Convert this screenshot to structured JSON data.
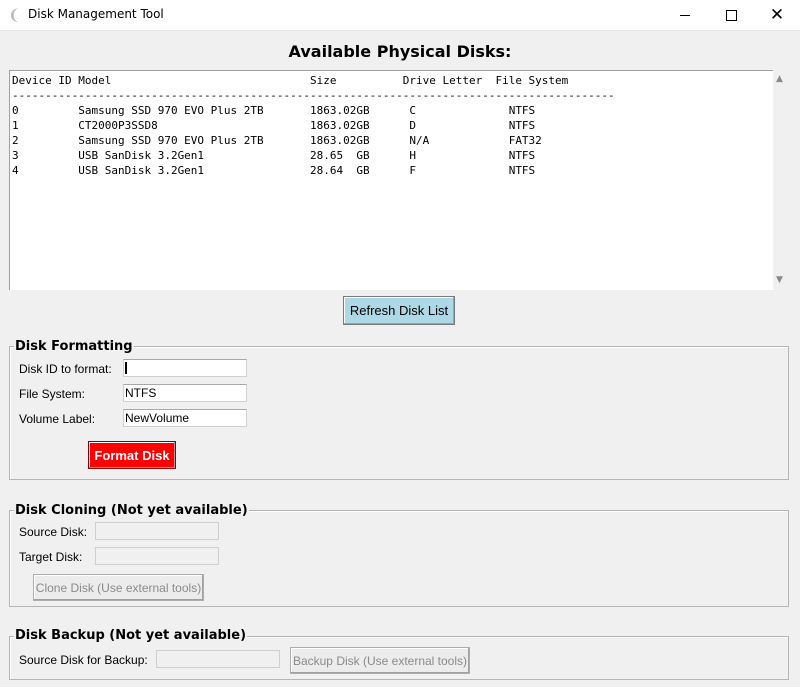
{
  "window": {
    "title": "Disk Management Tool",
    "app_icon": "feather-icon",
    "controls": {
      "minimize": "minimize-icon",
      "maximize": "maximize-icon",
      "close_glyph": "✕"
    }
  },
  "heading": "Available Physical Disks:",
  "disk_table": {
    "header": "Device ID Model                              Size          Drive Letter  File System",
    "separator": "-------------------------------------------------------------------------------------------",
    "columns": [
      "Device ID",
      "Model",
      "Size",
      "Drive Letter",
      "File System"
    ],
    "rows": [
      {
        "id": "0",
        "model": "Samsung SSD 970 EVO Plus 2TB",
        "size": "1863.02GB",
        "letter": "C",
        "fs": "NTFS"
      },
      {
        "id": "1",
        "model": "CT2000P3SSD8",
        "size": "1863.02GB",
        "letter": "D",
        "fs": "NTFS"
      },
      {
        "id": "2",
        "model": "Samsung SSD 970 EVO Plus 2TB",
        "size": "1863.02GB",
        "letter": "N/A",
        "fs": "FAT32"
      },
      {
        "id": "3",
        "model": "USB SanDisk 3.2Gen1",
        "size": "28.65  GB",
        "letter": "H",
        "fs": "NTFS"
      },
      {
        "id": "4",
        "model": "USB SanDisk 3.2Gen1",
        "size": "28.64  GB",
        "letter": "F",
        "fs": "NTFS"
      }
    ]
  },
  "refresh_button": "Refresh Disk List",
  "formatting": {
    "title": "Disk Formatting",
    "disk_id_label": "Disk ID to format:",
    "disk_id_value": "",
    "fs_label": "File System:",
    "fs_value": "NTFS",
    "volume_label": "Volume Label:",
    "volume_value": "NewVolume",
    "format_button": "Format Disk",
    "format_button_color": "#ff0000"
  },
  "cloning": {
    "title": "Disk Cloning (Not yet available)",
    "source_label": "Source Disk:",
    "source_value": "",
    "target_label": "Target Disk:",
    "target_value": "",
    "clone_button": "Clone Disk (Use external tools)"
  },
  "backup": {
    "title": "Disk Backup (Not yet available)",
    "source_label": "Source Disk for Backup:",
    "source_value": "",
    "backup_button": "Backup Disk (Use external tools)"
  },
  "colors": {
    "refresh_button": "#add8e6",
    "format_button": "#ff0000"
  }
}
